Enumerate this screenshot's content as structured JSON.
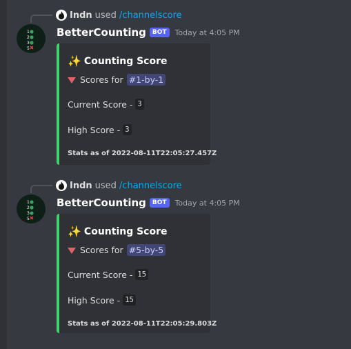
{
  "messages": [
    {
      "reply": {
        "user": "Indn",
        "action": "used",
        "command": "/channelscore"
      },
      "author": "BetterCounting",
      "bot_tag": "BOT",
      "timestamp": "Today at 4:05 PM",
      "embed": {
        "title": "Counting Score",
        "scores_for": "Scores for",
        "channel": "1-by-1",
        "current_label": "Current Score -",
        "current_value": "3",
        "high_label": "High Score -",
        "high_value": "3",
        "stats": "Stats as of 2022-08-11T22:05:27.457Z"
      }
    },
    {
      "reply": {
        "user": "Indn",
        "action": "used",
        "command": "/channelscore"
      },
      "author": "BetterCounting",
      "bot_tag": "BOT",
      "timestamp": "Today at 4:05 PM",
      "embed": {
        "title": "Counting Score",
        "scores_for": "Scores for",
        "channel": "5-by-5",
        "current_label": "Current Score -",
        "current_value": "15",
        "high_label": "High Score -",
        "high_value": "15",
        "stats": "Stats as of 2022-08-11T22:05:29.803Z"
      }
    }
  ],
  "colors": {
    "background": "#36393f",
    "embed_bg": "#2f3136",
    "embed_accent": "#43d36b",
    "bot_tag": "#5865f2",
    "command_link": "#00aff4",
    "channel_pill": "#414675"
  },
  "icons": [
    "fire-avatar-icon",
    "sparkles-icon",
    "red-triangle-down-icon",
    "channel-hash-icon",
    "bot-avatar-checklist-icon"
  ]
}
